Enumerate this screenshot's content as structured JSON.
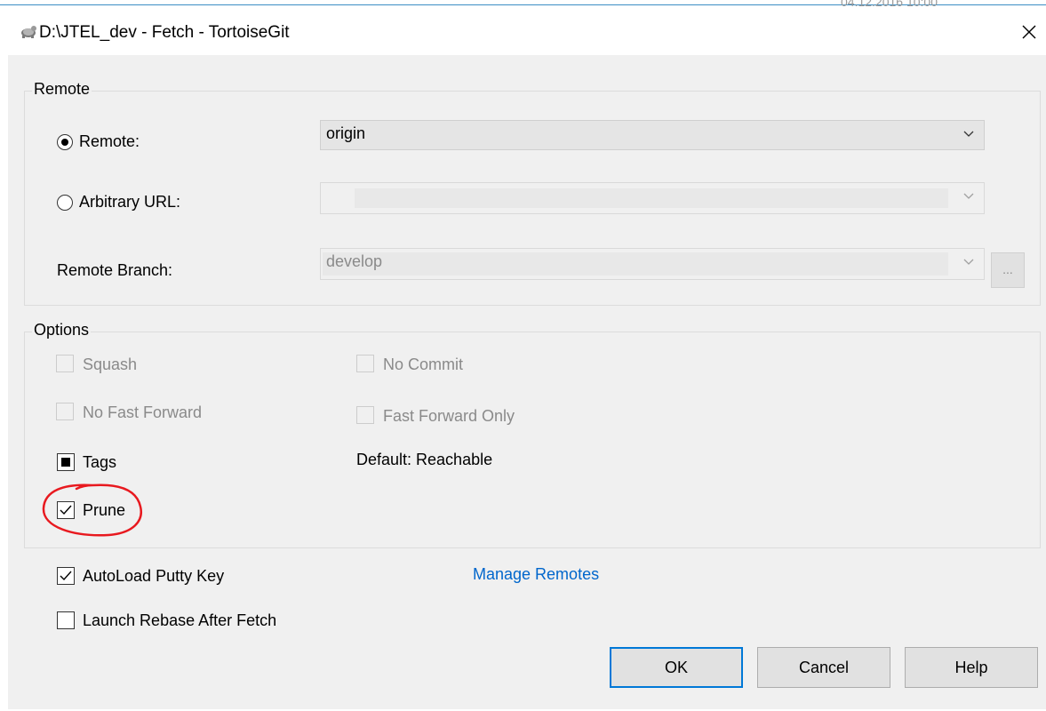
{
  "background_window": {
    "timestamp_text": "04.12.2016 10:00"
  },
  "window": {
    "title": "D:\\JTEL_dev - Fetch - TortoiseGit",
    "icon": "tortoisegit-turtle-icon",
    "close_glyph": "✕"
  },
  "remote_group": {
    "label": "Remote",
    "remote_radio": {
      "label": "Remote:",
      "selected": true
    },
    "remote_combo": {
      "value": "origin"
    },
    "url_radio": {
      "label": "Arbitrary URL:",
      "selected": false
    },
    "url_combo": {
      "value": ""
    },
    "branch": {
      "label": "Remote Branch:",
      "value": "develop",
      "browse_label": "..."
    }
  },
  "options_group": {
    "label": "Options",
    "squash": {
      "label": "Squash",
      "enabled": false,
      "checked": false
    },
    "no_commit": {
      "label": "No Commit",
      "enabled": false,
      "checked": false
    },
    "no_fast_forward": {
      "label": "No Fast Forward",
      "enabled": false,
      "checked": false
    },
    "fast_forward_only": {
      "label": "Fast Forward Only",
      "enabled": false,
      "checked": false
    },
    "tags": {
      "label": "Tags",
      "state": "indeterminate"
    },
    "tags_default": "Default: Reachable",
    "prune": {
      "label": "Prune",
      "checked": true,
      "highlight_color": "#e8191f"
    }
  },
  "autoload": {
    "label": "AutoLoad Putty Key",
    "checked": true
  },
  "launch_rebase": {
    "label": "Launch Rebase After Fetch",
    "checked": false
  },
  "manage_remotes": "Manage Remotes",
  "buttons": {
    "ok": "OK",
    "cancel": "Cancel",
    "help": "Help"
  },
  "colors": {
    "link": "#0066cc",
    "default_button_border": "#0078d7",
    "dialog_bg": "#f0f0f0"
  }
}
